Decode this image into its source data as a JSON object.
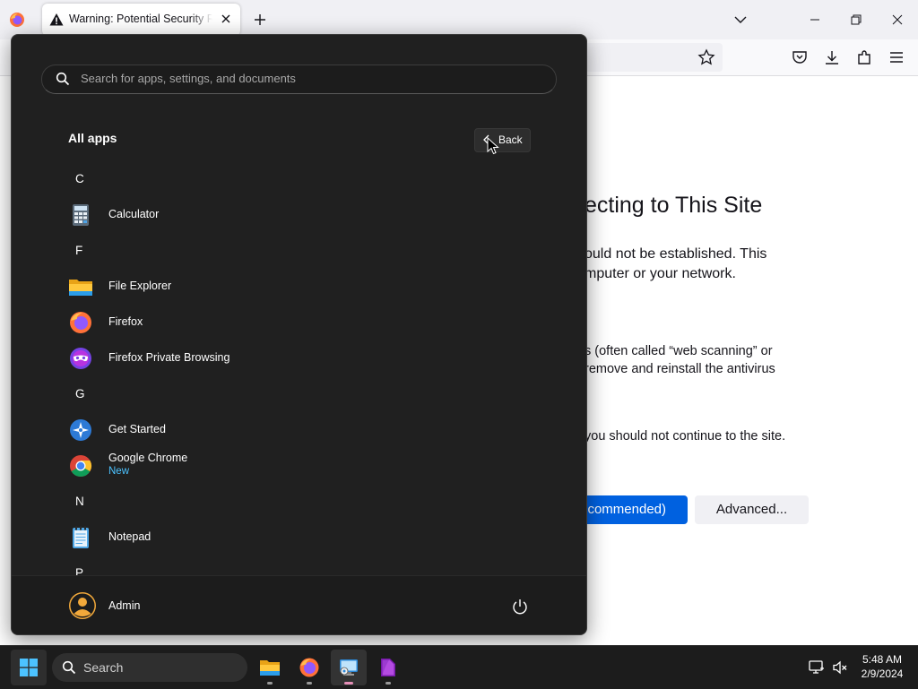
{
  "browser": {
    "tab_title": "Warning: Potential Security Risk Ahead",
    "colors": {
      "tabbar": "#f0f0f4",
      "primary_button": "#0061e0"
    }
  },
  "page": {
    "heading": "ecting to This Site",
    "para1_line1": "ould not be established. This",
    "para1_line2": "mputer or your network.",
    "para2_line1": "s (often called “web scanning” or",
    "para2_line2": "remove and reinstall the antivirus",
    "para3": "you should not continue to the site.",
    "primary_button": "commended)",
    "advanced_button": "Advanced..."
  },
  "start_menu": {
    "search_placeholder": "Search for apps, settings, and documents",
    "section_title": "All apps",
    "back_label": "Back",
    "groups": [
      {
        "letter": "C",
        "apps": [
          {
            "name": "Calculator",
            "icon": "calculator-icon"
          }
        ]
      },
      {
        "letter": "F",
        "apps": [
          {
            "name": "File Explorer",
            "icon": "file-explorer-icon"
          },
          {
            "name": "Firefox",
            "icon": "firefox-icon"
          },
          {
            "name": "Firefox Private Browsing",
            "icon": "firefox-private-icon"
          }
        ]
      },
      {
        "letter": "G",
        "apps": [
          {
            "name": "Get Started",
            "icon": "get-started-icon"
          },
          {
            "name": "Google Chrome",
            "badge": "New",
            "icon": "chrome-icon"
          }
        ]
      },
      {
        "letter": "N",
        "apps": [
          {
            "name": "Notepad",
            "icon": "notepad-icon"
          }
        ]
      },
      {
        "letter": "P",
        "apps": []
      }
    ],
    "user_name": "Admin"
  },
  "taskbar": {
    "search_label": "Search",
    "pinned": [
      "file-explorer-icon",
      "firefox-icon",
      "remote-desktop-icon",
      "onenote-icon"
    ],
    "time": "5:48 AM",
    "date": "2/9/2024"
  }
}
